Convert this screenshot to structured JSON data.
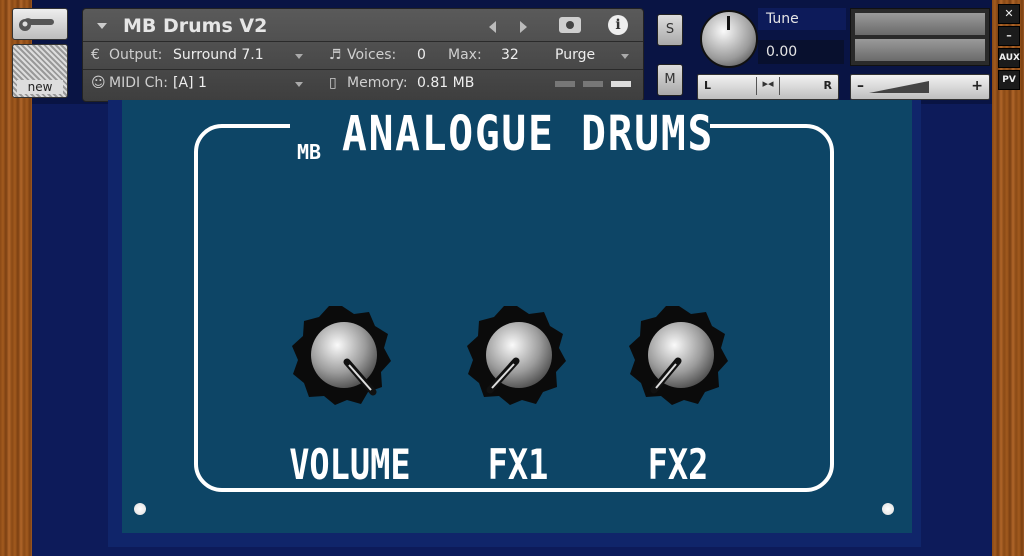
{
  "header": {
    "instrument_name": "MB Drums V2",
    "output_label": "Output:",
    "output_value": "Surround 7.1",
    "voices_label": "Voices:",
    "voices_value": "0",
    "max_label": "Max:",
    "max_value": "32",
    "purge_label": "Purge",
    "midi_label": "MIDI Ch:",
    "midi_value": "[A]  1",
    "memory_label": "Memory:",
    "memory_value": "0.81 MB"
  },
  "left_tools": {
    "new_label": "new"
  },
  "solo_label": "S",
  "mute_label": "M",
  "tune": {
    "label": "Tune",
    "value": "0.00"
  },
  "pan": {
    "left": "L",
    "right": "R"
  },
  "volume_slider": {
    "minus": "–",
    "plus": "+"
  },
  "side_buttons": {
    "close": "✕",
    "minimize": "–",
    "aux": "AUX",
    "pv": "PV"
  },
  "panel": {
    "title_prefix": "MB",
    "title_main": "ANALOGUE DRUMS",
    "knobs": [
      {
        "label": "VOLUME"
      },
      {
        "label": "FX1"
      },
      {
        "label": "FX2"
      }
    ]
  },
  "colors": {
    "panel_bg": "#0d4566",
    "frame_bg": "#0d1b5a",
    "label_white": "#ffffff"
  }
}
